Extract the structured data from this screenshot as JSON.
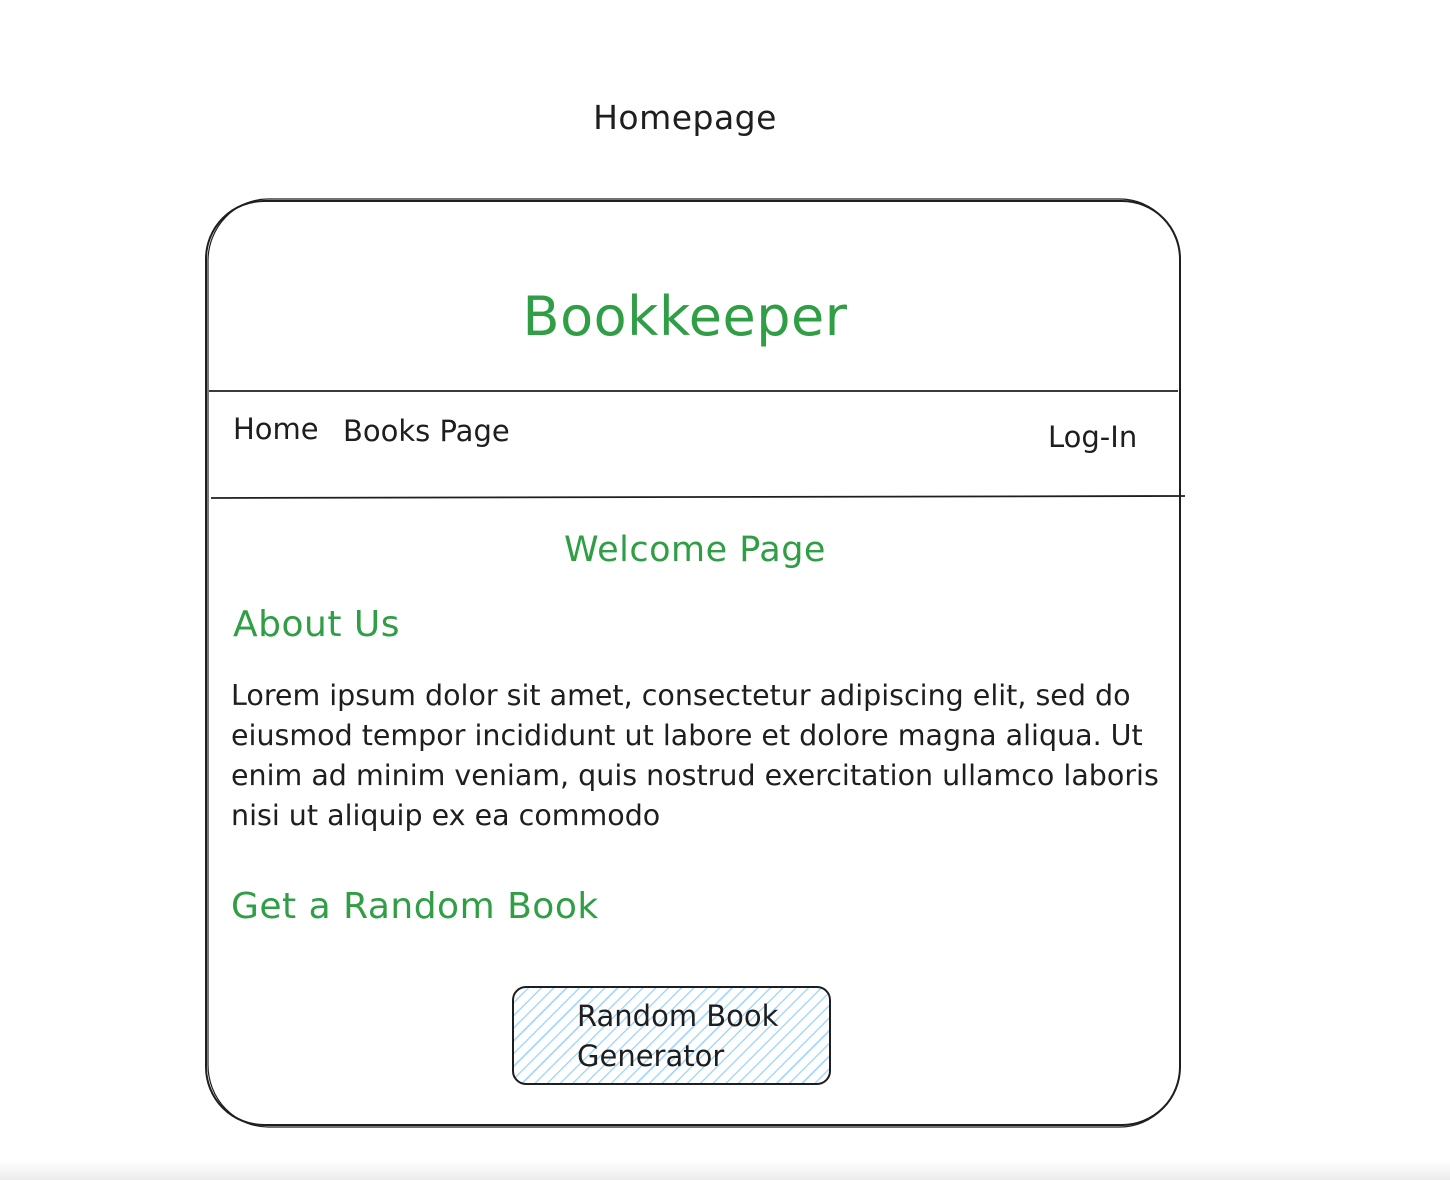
{
  "canvas": {
    "title": "Homepage"
  },
  "app": {
    "brand": "Bookkeeper",
    "brand_color": "#2f9e44",
    "stroke_color": "#1e1e1e",
    "button_hatch_color": "#a5d8ff"
  },
  "nav": {
    "home": "Home",
    "books": "Books Page",
    "login": "Log-In"
  },
  "main": {
    "welcome": "Welcome Page",
    "about_heading": "About Us",
    "about_text": "Lorem ipsum dolor sit amet, consectetur adipiscing elit, sed do eiusmod tempor incididunt ut labore et dolore magna aliqua. Ut enim ad minim veniam, quis nostrud exercitation ullamco laboris nisi ut aliquip ex ea commodo",
    "random_heading": "Get a Random Book",
    "random_button": "Random Book Generator"
  }
}
